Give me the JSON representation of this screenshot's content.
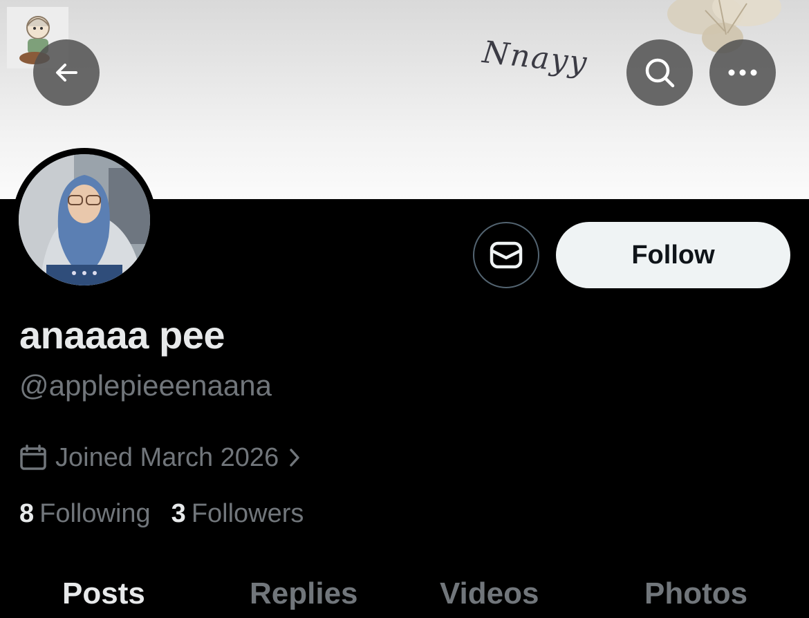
{
  "banner": {
    "signature": "Nnayy"
  },
  "profile": {
    "display_name": "anaaaa pee",
    "handle": "@applepieeenaana",
    "joined": "Joined March 2026"
  },
  "actions": {
    "follow_label": "Follow"
  },
  "stats": {
    "following_count": "8",
    "following_label": "Following",
    "followers_count": "3",
    "followers_label": "Followers"
  },
  "tabs": [
    {
      "label": "Posts",
      "active": true
    },
    {
      "label": "Replies",
      "active": false
    },
    {
      "label": "Videos",
      "active": false
    },
    {
      "label": "Photos",
      "active": false
    }
  ],
  "icons": {
    "back": "arrow-left-icon",
    "search": "search-icon",
    "more": "more-horizontal-icon",
    "message": "envelope-icon",
    "calendar": "calendar-icon",
    "chevron": "chevron-right-icon"
  },
  "colors": {
    "background": "#000000",
    "text_primary": "#e7e9ea",
    "text_secondary": "#71767b",
    "follow_bg": "#eff3f4",
    "circle_btn": "#505050"
  }
}
